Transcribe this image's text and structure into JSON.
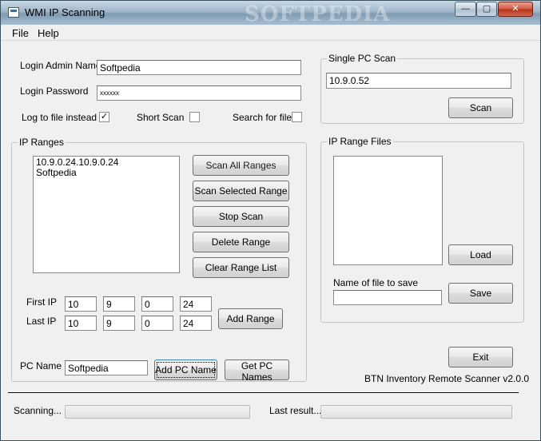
{
  "window": {
    "title": "WMI IP Scanning",
    "watermark": "SOFTPEDIA",
    "controls": {
      "minimize": "—",
      "maximize": "▢",
      "close": "✕"
    }
  },
  "menu": [
    "File",
    "Help"
  ],
  "login": {
    "admin_label": "Login Admin Name",
    "admin_value": "Softpedia",
    "password_label": "Login Password",
    "password_value": "xxxxxx"
  },
  "options": {
    "log_label": "Log to file instead",
    "log_checked": "✓",
    "short_label": "Short Scan",
    "search_label": "Search for file"
  },
  "ip_ranges": {
    "title": "IP Ranges",
    "items": [
      "10.9.0.24.10.9.0.24",
      "Softpedia"
    ],
    "buttons": {
      "scan_all": "Scan All Ranges",
      "scan_selected": "Scan Selected Range",
      "stop": "Stop Scan",
      "delete": "Delete Range",
      "clear": "Clear Range List"
    },
    "first_ip_label": "First IP",
    "first_ip": [
      "10",
      "9",
      "0",
      "24"
    ],
    "last_ip_label": "Last IP",
    "last_ip": [
      "10",
      "9",
      "0",
      "24"
    ],
    "add_range": "Add Range"
  },
  "pc_name": {
    "label": "PC Name",
    "value": "Softpedia",
    "add_button": "Add PC Name",
    "get_button": "Get PC Names"
  },
  "single_scan": {
    "title": "Single PC Scan",
    "ip_value": "10.9.0.52",
    "scan_button": "Scan"
  },
  "range_files": {
    "title": "IP Range Files",
    "load_button": "Load",
    "save_name_label": "Name of file to save",
    "save_name_value": "",
    "save_button": "Save"
  },
  "exit_button": "Exit",
  "version": "BTN Inventory Remote Scanner v2.0.0",
  "status": {
    "scanning_label": "Scanning...",
    "last_result_label": "Last result..."
  }
}
